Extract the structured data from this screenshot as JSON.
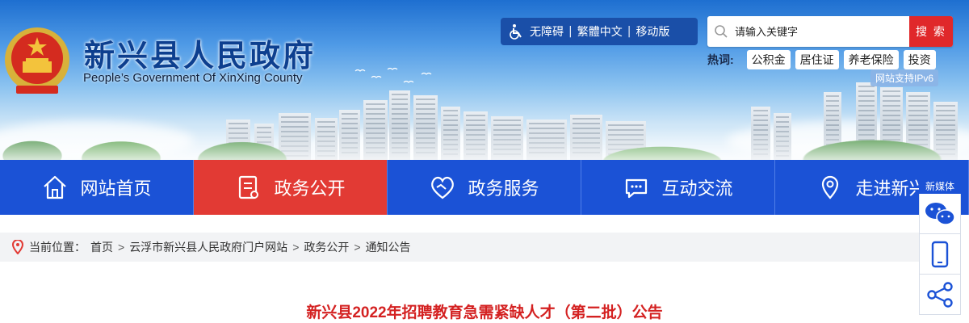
{
  "header": {
    "title": "新兴县人民政府",
    "subtitle": "People’s Government Of XinXing County",
    "ipv6_badge": "网站支持IPv6"
  },
  "access": {
    "links": [
      "无障碍",
      "繁體中文",
      "移动版"
    ],
    "separator": "|"
  },
  "search": {
    "placeholder": "请输入关键字",
    "button_label": "搜 索"
  },
  "hot": {
    "label": "热词:",
    "tags": [
      "公积金",
      "居住证",
      "养老保险",
      "投资"
    ]
  },
  "nav": {
    "items": [
      {
        "label": "网站首页",
        "icon": "home-icon"
      },
      {
        "label": "政务公开",
        "icon": "document-icon",
        "active": true
      },
      {
        "label": "政务服务",
        "icon": "handshake-heart-icon"
      },
      {
        "label": "互动交流",
        "icon": "chat-bubble-icon"
      },
      {
        "label": "走进新兴",
        "icon": "map-pin-icon"
      }
    ]
  },
  "sidebar": {
    "tag": "新媒体",
    "buttons": [
      "wechat-icon",
      "mobile-icon",
      "share-icon"
    ]
  },
  "breadcrumb": {
    "label": "当前位置：",
    "items": [
      "首页",
      "云浮市新兴县人民政府门户网站",
      "政务公开",
      "通知公告"
    ],
    "separator": ">"
  },
  "article": {
    "title": "新兴县2022年招聘教育急需紧缺人才（第二批）公告"
  },
  "colors": {
    "nav_bg": "#1b52d6",
    "nav_active": "#e23a34",
    "title_blue": "#0d3f8f",
    "article_red": "#d42121",
    "search_button": "#e0282a"
  }
}
